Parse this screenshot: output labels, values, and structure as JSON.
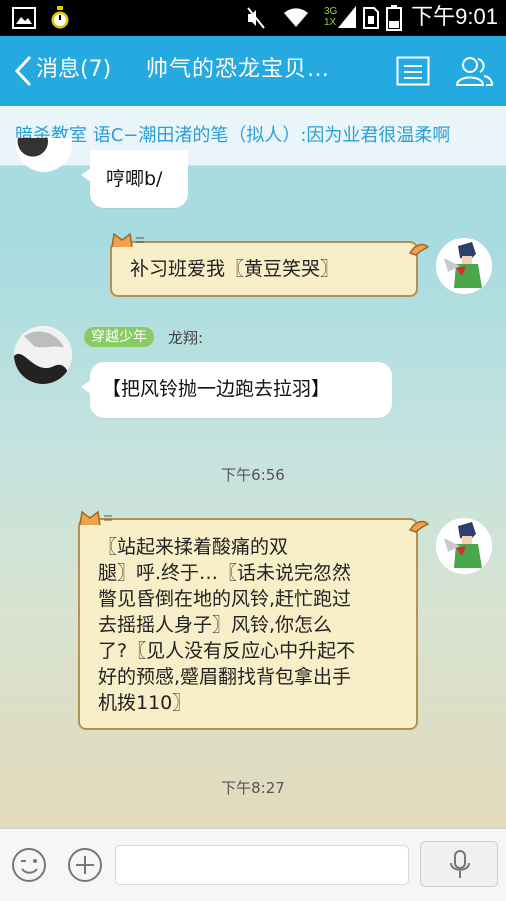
{
  "status_bar": {
    "time": "下午9:01",
    "network": "3G 1X",
    "icons": [
      "image-icon",
      "timer-icon",
      "mute-icon",
      "wifi-icon",
      "signal-icon",
      "sim-icon",
      "battery-icon"
    ]
  },
  "header": {
    "back_label": "消息(7)",
    "title": "帅气的恐龙宝贝…",
    "colors": {
      "bar": "#24aae1",
      "text": "#ffffff"
    }
  },
  "banner": {
    "text": "暗杀教室  语C−潮田渚的笔（拟人）:因为业君很温柔啊"
  },
  "messages": [
    {
      "type": "white",
      "text": "哼唧b/"
    },
    {
      "type": "cat",
      "text": "补习班爱我〖黄豆笑哭〗"
    },
    {
      "type": "white",
      "badge": "穿越少年",
      "sender": "龙翔:",
      "text": "【把风铃抛一边跑去拉羽】"
    },
    {
      "type": "time",
      "text": "下午6:56"
    },
    {
      "type": "cat",
      "lines": [
        "〖站起来揉着酸痛的双",
        "腿〗呼.终于…〖话未说完忽然",
        "瞥见昏倒在地的风铃,赶忙跑过",
        "去摇摇人身子〗风铃,你怎么",
        "了?〖见人没有反应心中升起不",
        "好的预感,蹙眉翻找背包拿出手",
        "机拨110〗"
      ]
    },
    {
      "type": "time",
      "text": "下午8:27"
    }
  ],
  "input_bar": {
    "icons": [
      "emoji-icon",
      "plus-icon",
      "microphone-icon"
    ],
    "placeholder": ""
  }
}
